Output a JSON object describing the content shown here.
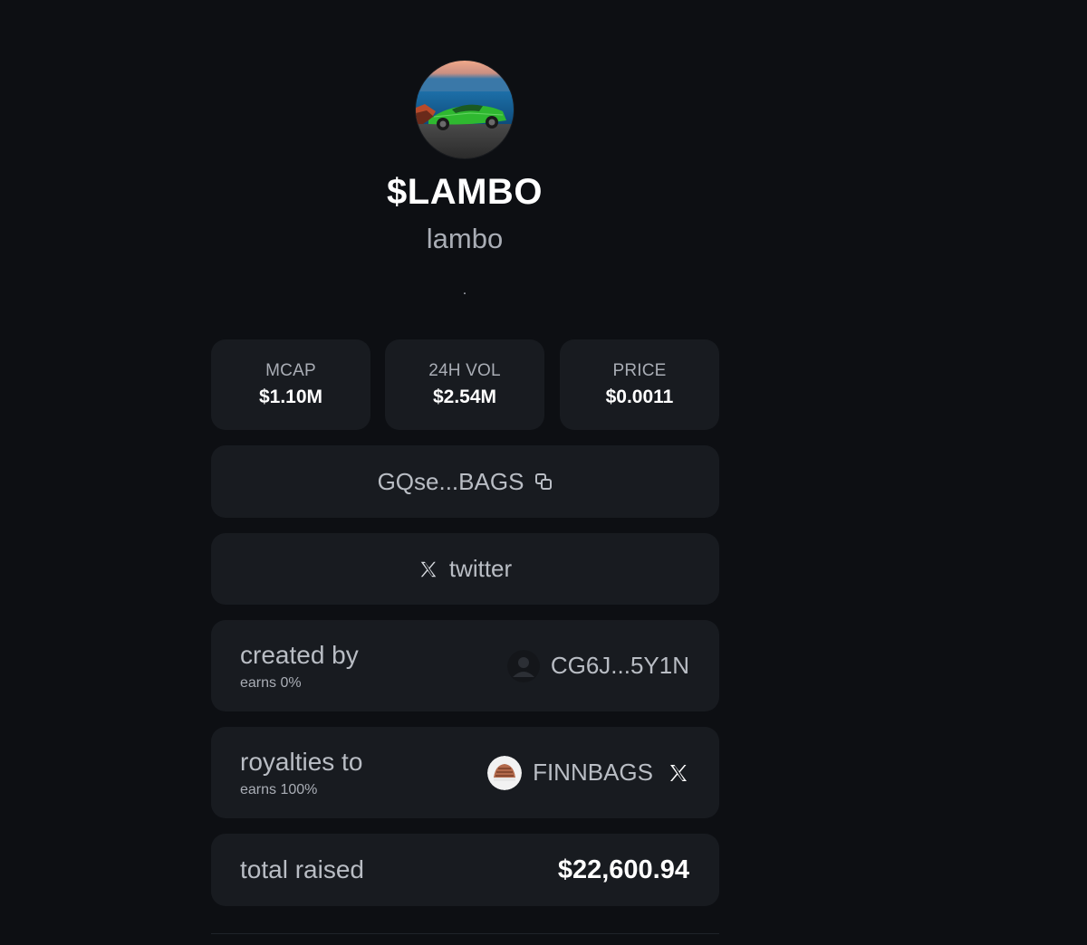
{
  "token": {
    "ticker": "$LAMBO",
    "name": "lambo",
    "description": "."
  },
  "stats": [
    {
      "label": "MCAP",
      "value": "$1.10M"
    },
    {
      "label": "24H VOL",
      "value": "$2.54M"
    },
    {
      "label": "PRICE",
      "value": "$0.0011"
    }
  ],
  "contract": {
    "address": "GQse...BAGS",
    "icon": "copy-icon"
  },
  "social": {
    "label": "twitter",
    "icon": "x-logo-icon"
  },
  "creator": {
    "title": "created by",
    "earns": "earns 0%",
    "username": "CG6J...5Y1N",
    "avatar": "default-user-avatar"
  },
  "royalties": {
    "title": "royalties to",
    "earns": "earns 100%",
    "username": "FINNBAGS",
    "avatar": "user-avatar",
    "link_icon": "x-logo-icon"
  },
  "total": {
    "label": "total raised",
    "value": "$22,600.94"
  },
  "colors": {
    "background": "#0d0f13",
    "card": "#181b20",
    "text_primary": "#ffffff",
    "text_muted": "#a9adb5"
  }
}
